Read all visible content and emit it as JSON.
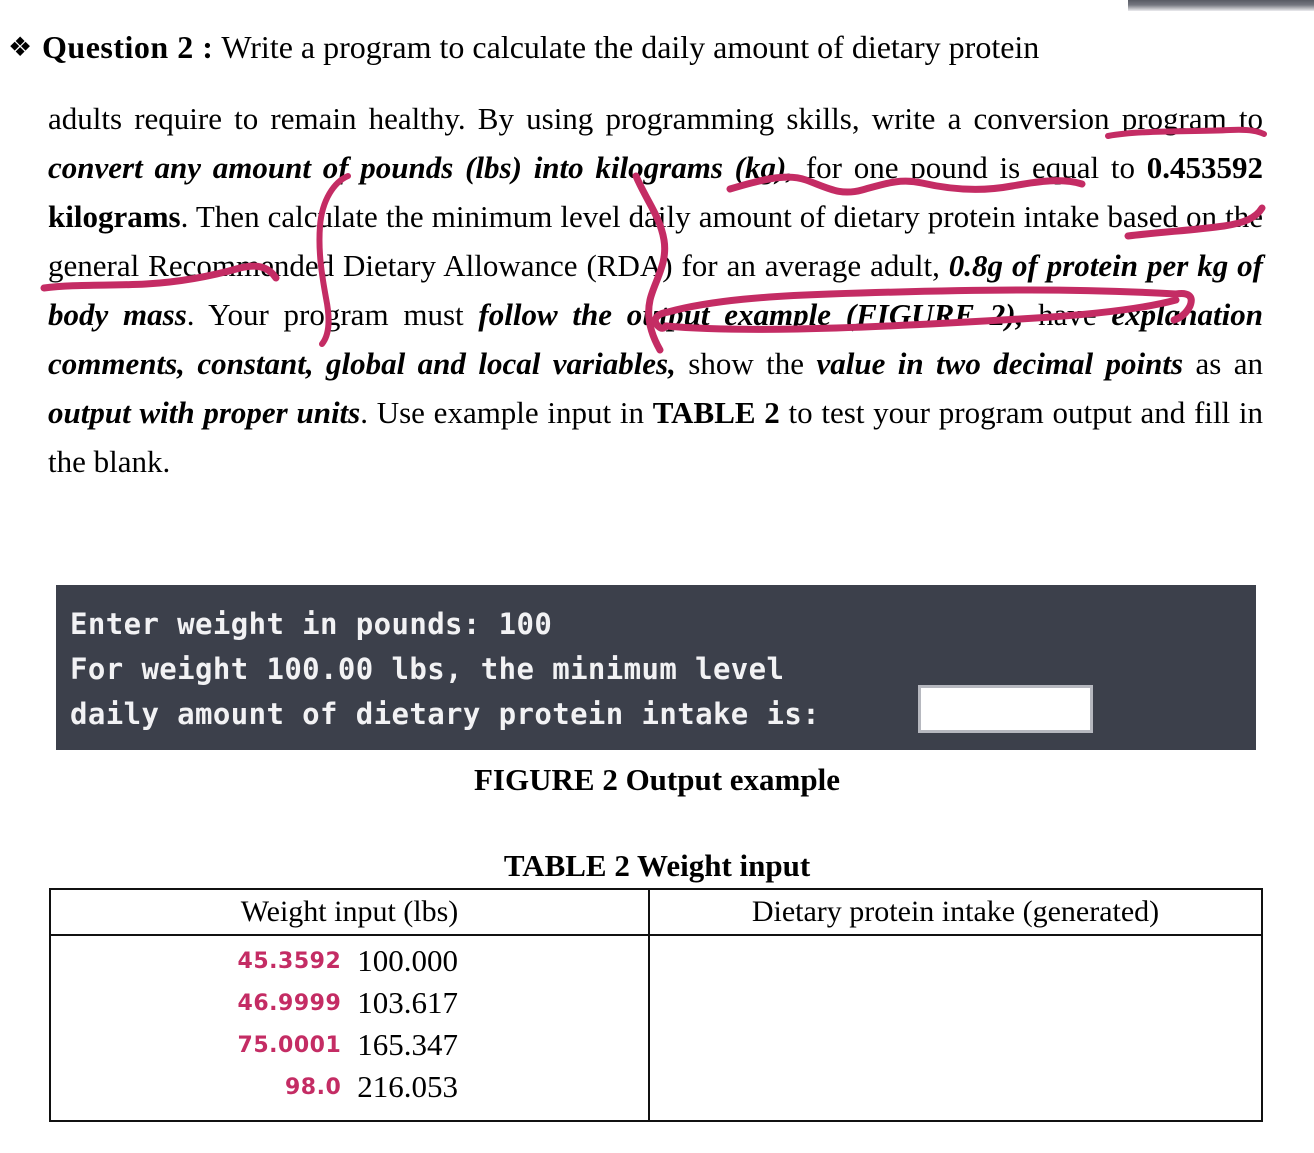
{
  "question": {
    "bullet_icon": "diamond-bullet-icon",
    "label": "Question 2 :",
    "line1_rest": "Write a program to calculate the daily amount of dietary protein",
    "para_html_parts": {
      "p1_a": "adults require to remain healthy. By using programming skills, write a conversion program to ",
      "p1_bi1": "convert any amount of pounds (lbs) into kilograms (kg),",
      "p1_b": " for one pound is equal to ",
      "p1_bb1": "0.453592 kilograms",
      "p1_c": ". Then calculate the minimum level daily amount of dietary protein intake based on the general Recommended Dietary Allowance (RDA) for an average adult, ",
      "p1_bi2": "0.8g of protein per kg of body mass",
      "p1_d": ". Your program must ",
      "p1_bi3": "follow the output example (FIGURE 2),",
      "p1_e": " have ",
      "p1_bi4": "explanation comments, constant, global and local variables,",
      "p1_f": " show the ",
      "p1_bi5": "value in two decimal points",
      "p1_g": " as an ",
      "p1_bi6": "output with proper units",
      "p1_h": ". Use example input in ",
      "p1_bb2": "TABLE 2",
      "p1_i": " to test your program output and fill in the blank."
    }
  },
  "console": {
    "line1": "Enter weight in pounds: 100",
    "line2": "For weight 100.00 lbs, the minimum level",
    "line3": "daily amount of dietary protein intake is:",
    "answer_value": "",
    "background_color": "#3c404b",
    "text_color": "#f2f2f4"
  },
  "figure_caption": "FIGURE 2 Output example",
  "table_caption": "TABLE 2 Weight input",
  "table": {
    "headers": [
      "Weight input (lbs)",
      "Dietary protein intake (generated)"
    ],
    "rows": [
      {
        "handwritten": "45.3592",
        "weight": "100.000",
        "generated": ""
      },
      {
        "handwritten": "46.9999",
        "weight": "103.617",
        "generated": ""
      },
      {
        "handwritten": "75.0001",
        "weight": "165.347",
        "generated": ""
      },
      {
        "handwritten": "98.0",
        "weight": "216.053",
        "generated": ""
      }
    ]
  },
  "annotation": {
    "ink_color": "#c42c64",
    "marks": [
      "underline-under-conversion",
      "wavy-underline-under-lbs-into-kilograms-kg",
      "vertical-curve-left-from-convert",
      "vertical-wavy-curve-right-from-pounds",
      "hook-under-minimum-level-daily",
      "underline-under-amount-of-dietary",
      "strikethrough-oval-around-0.8g-of-protein-per-kg-of-body-mass"
    ]
  }
}
